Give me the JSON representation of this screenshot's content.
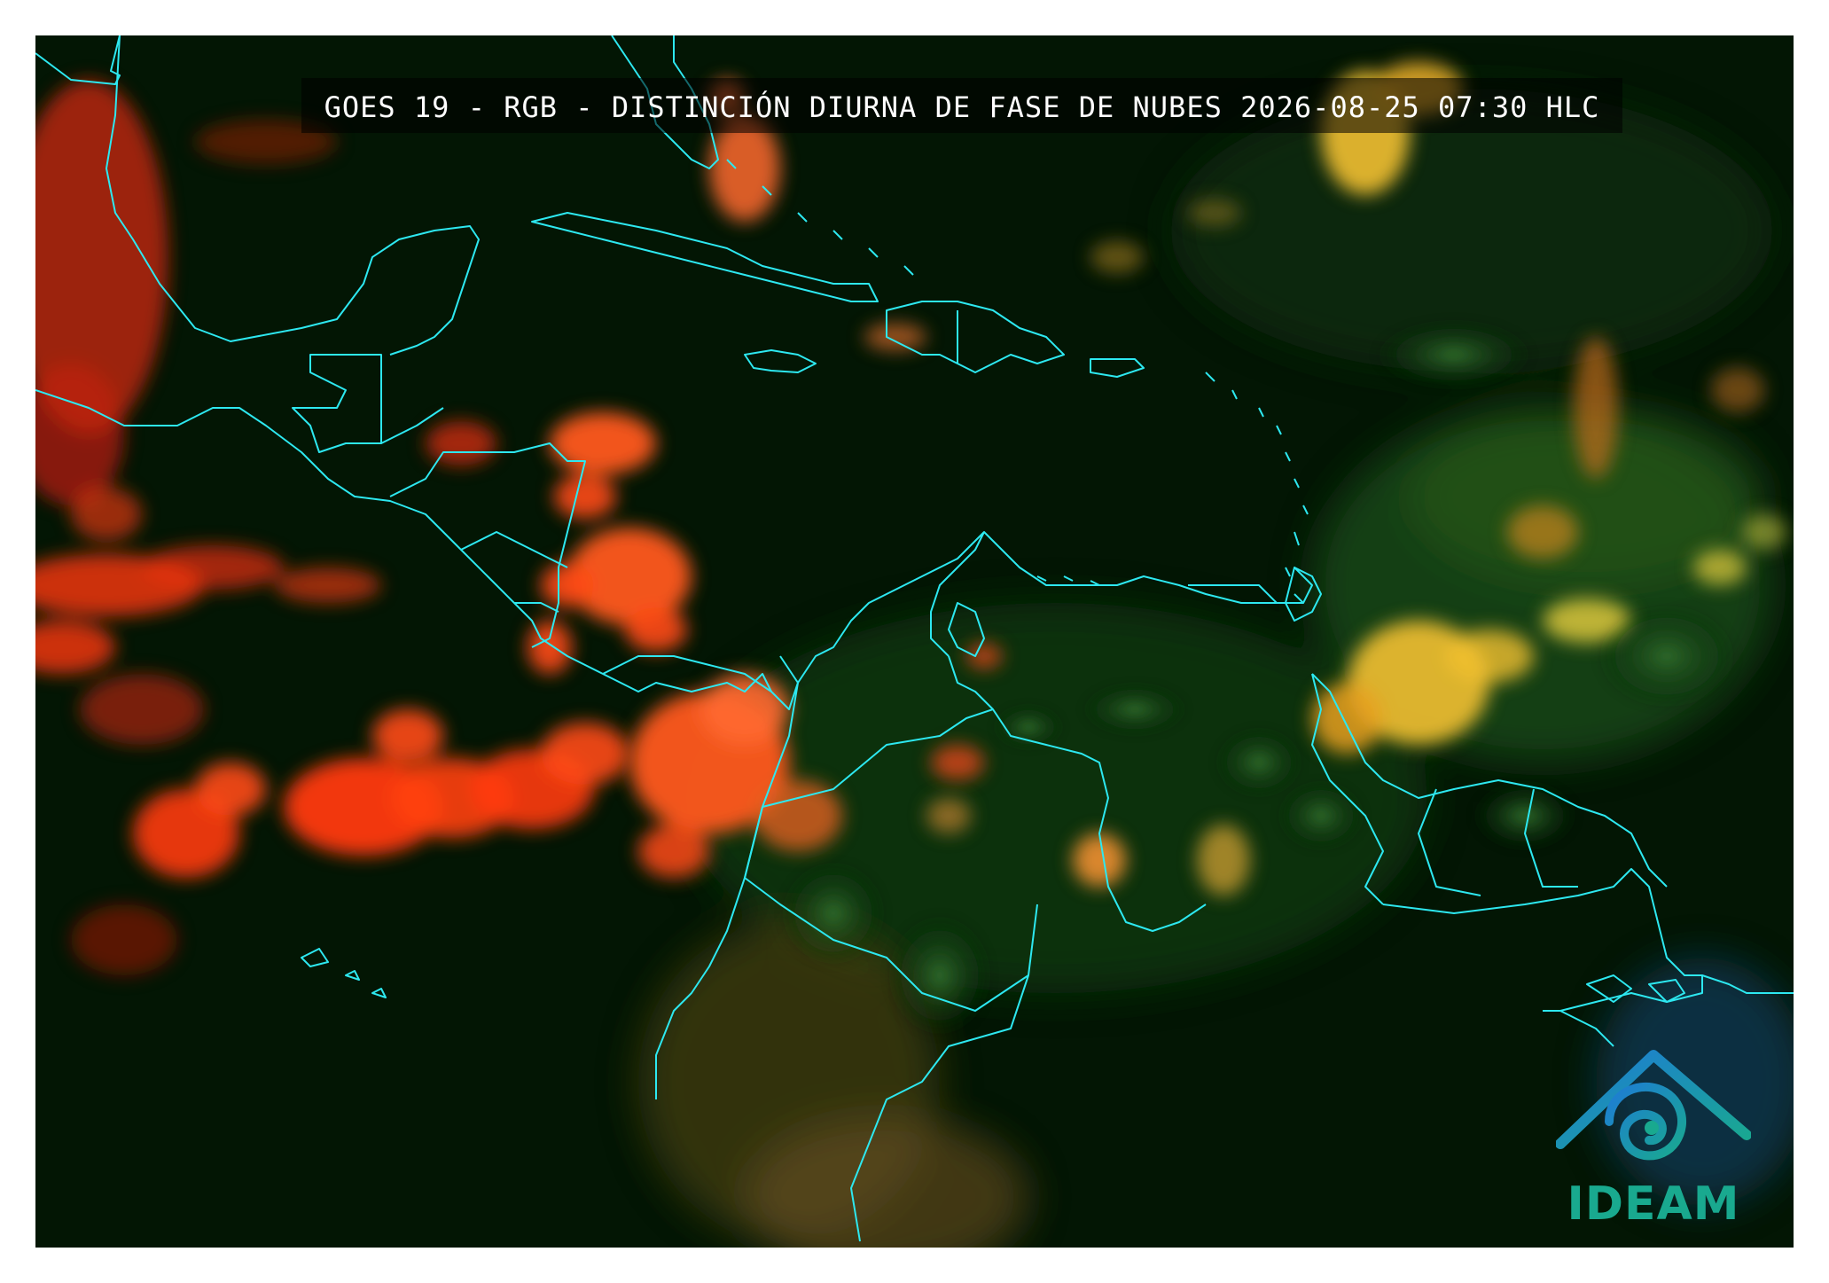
{
  "map": {
    "title": "GOES 19 - RGB - DISTINCIÓN DIURNA DE FASE DE NUBES 2026-08-25 07:30 HLC",
    "background_color": "#021202",
    "coastline_color": "#2de8f0",
    "cloud_colors": {
      "ice_cloud": "#ff3a10",
      "mixed_cloud": "#ffb020",
      "water_cloud": "#e8d84a",
      "vegetation": "#0c3a14",
      "desert": "#6a5a1c"
    }
  },
  "logo": {
    "text": "IDEAM",
    "icon": "mountain-swirl-icon",
    "color": "#19a98f"
  }
}
